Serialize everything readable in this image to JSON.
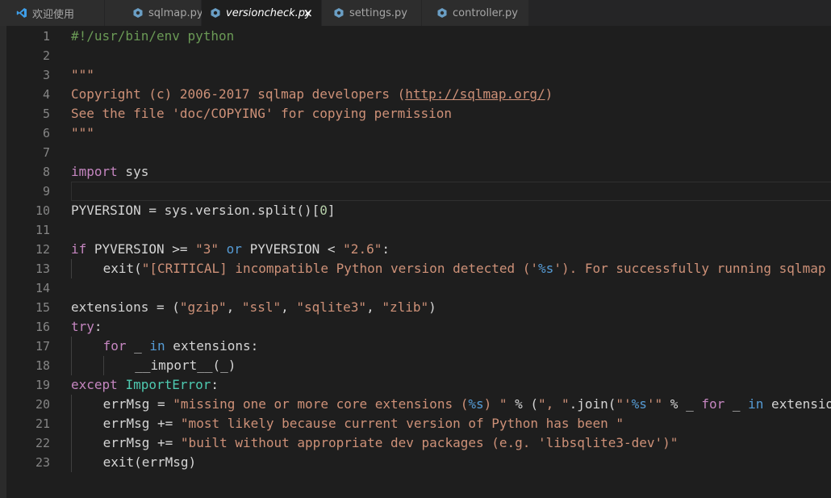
{
  "tabs": [
    {
      "label": "欢迎使用",
      "icon": "vscode-icon",
      "active": false
    },
    {
      "label": "sqlmap.py",
      "icon": "python-file-icon",
      "active": false
    },
    {
      "label": "versioncheck.py",
      "icon": "python-file-icon",
      "active": true,
      "close": "×"
    },
    {
      "label": "settings.py",
      "icon": "python-file-icon",
      "active": false
    },
    {
      "label": "controller.py",
      "icon": "python-file-icon",
      "active": false
    }
  ],
  "editor": {
    "current_line": 9,
    "lines": [
      {
        "num": "1",
        "tokens": [
          {
            "t": "#!/usr/bin/env python",
            "c": "cmt"
          }
        ]
      },
      {
        "num": "2",
        "tokens": []
      },
      {
        "num": "3",
        "tokens": [
          {
            "t": "\"\"\"",
            "c": "str"
          }
        ]
      },
      {
        "num": "4",
        "tokens": [
          {
            "t": "Copyright (c) 2006-2017 sqlmap developers (",
            "c": "str"
          },
          {
            "t": "http://sqlmap.org/",
            "c": "str lnk"
          },
          {
            "t": ")",
            "c": "str"
          }
        ]
      },
      {
        "num": "5",
        "tokens": [
          {
            "t": "See the file 'doc/COPYING' for copying permission",
            "c": "str"
          }
        ]
      },
      {
        "num": "6",
        "tokens": [
          {
            "t": "\"\"\"",
            "c": "str"
          }
        ]
      },
      {
        "num": "7",
        "tokens": []
      },
      {
        "num": "8",
        "tokens": [
          {
            "t": "import",
            "c": "kw"
          },
          {
            "t": " sys",
            "c": ""
          }
        ]
      },
      {
        "num": "9",
        "tokens": []
      },
      {
        "num": "10",
        "tokens": [
          {
            "t": "PYVERSION = sys.version.split()[",
            "c": ""
          },
          {
            "t": "0",
            "c": "num"
          },
          {
            "t": "]",
            "c": ""
          }
        ]
      },
      {
        "num": "11",
        "tokens": []
      },
      {
        "num": "12",
        "tokens": [
          {
            "t": "if",
            "c": "kw"
          },
          {
            "t": " PYVERSION >= ",
            "c": ""
          },
          {
            "t": "\"3\"",
            "c": "str"
          },
          {
            "t": " ",
            "c": ""
          },
          {
            "t": "or",
            "c": "kw2"
          },
          {
            "t": " PYVERSION < ",
            "c": ""
          },
          {
            "t": "\"2.6\"",
            "c": "str"
          },
          {
            "t": ":",
            "c": ""
          }
        ]
      },
      {
        "num": "13",
        "indent": 1,
        "tokens": [
          {
            "t": "exit(",
            "c": ""
          },
          {
            "t": "\"[CRITICAL] incompatible Python version detected ('",
            "c": "str"
          },
          {
            "t": "%s",
            "c": "esc"
          },
          {
            "t": "'). For successfully running sqlmap",
            "c": "str"
          }
        ]
      },
      {
        "num": "14",
        "tokens": []
      },
      {
        "num": "15",
        "tokens": [
          {
            "t": "extensions = (",
            "c": ""
          },
          {
            "t": "\"gzip\"",
            "c": "str"
          },
          {
            "t": ", ",
            "c": ""
          },
          {
            "t": "\"ssl\"",
            "c": "str"
          },
          {
            "t": ", ",
            "c": ""
          },
          {
            "t": "\"sqlite3\"",
            "c": "str"
          },
          {
            "t": ", ",
            "c": ""
          },
          {
            "t": "\"zlib\"",
            "c": "str"
          },
          {
            "t": ")",
            "c": ""
          }
        ]
      },
      {
        "num": "16",
        "tokens": [
          {
            "t": "try",
            "c": "kw"
          },
          {
            "t": ":",
            "c": ""
          }
        ]
      },
      {
        "num": "17",
        "indent": 1,
        "tokens": [
          {
            "t": "for",
            "c": "kw"
          },
          {
            "t": " _ ",
            "c": ""
          },
          {
            "t": "in",
            "c": "kw2"
          },
          {
            "t": " extensions:",
            "c": ""
          }
        ]
      },
      {
        "num": "18",
        "indent": 2,
        "tokens": [
          {
            "t": "__import__(_)",
            "c": ""
          }
        ]
      },
      {
        "num": "19",
        "tokens": [
          {
            "t": "except",
            "c": "kw"
          },
          {
            "t": " ",
            "c": ""
          },
          {
            "t": "ImportError",
            "c": "cls"
          },
          {
            "t": ":",
            "c": ""
          }
        ]
      },
      {
        "num": "20",
        "indent": 1,
        "tokens": [
          {
            "t": "errMsg = ",
            "c": ""
          },
          {
            "t": "\"missing one or more core extensions (",
            "c": "str"
          },
          {
            "t": "%s",
            "c": "esc"
          },
          {
            "t": ") \"",
            "c": "str"
          },
          {
            "t": " % (",
            "c": ""
          },
          {
            "t": "\", \"",
            "c": "str"
          },
          {
            "t": ".join(",
            "c": ""
          },
          {
            "t": "\"'",
            "c": "str"
          },
          {
            "t": "%s",
            "c": "esc"
          },
          {
            "t": "'\"",
            "c": "str"
          },
          {
            "t": " % _ ",
            "c": ""
          },
          {
            "t": "for",
            "c": "kw"
          },
          {
            "t": " _ ",
            "c": ""
          },
          {
            "t": "in",
            "c": "kw2"
          },
          {
            "t": " extensions",
            "c": ""
          }
        ]
      },
      {
        "num": "21",
        "indent": 1,
        "tokens": [
          {
            "t": "errMsg += ",
            "c": ""
          },
          {
            "t": "\"most likely because current version of Python has been \"",
            "c": "str"
          }
        ]
      },
      {
        "num": "22",
        "indent": 1,
        "tokens": [
          {
            "t": "errMsg += ",
            "c": ""
          },
          {
            "t": "\"built without appropriate dev packages (e.g. 'libsqlite3-dev')\"",
            "c": "str"
          }
        ]
      },
      {
        "num": "23",
        "indent": 1,
        "tokens": [
          {
            "t": "exit(errMsg)",
            "c": ""
          }
        ]
      }
    ]
  }
}
